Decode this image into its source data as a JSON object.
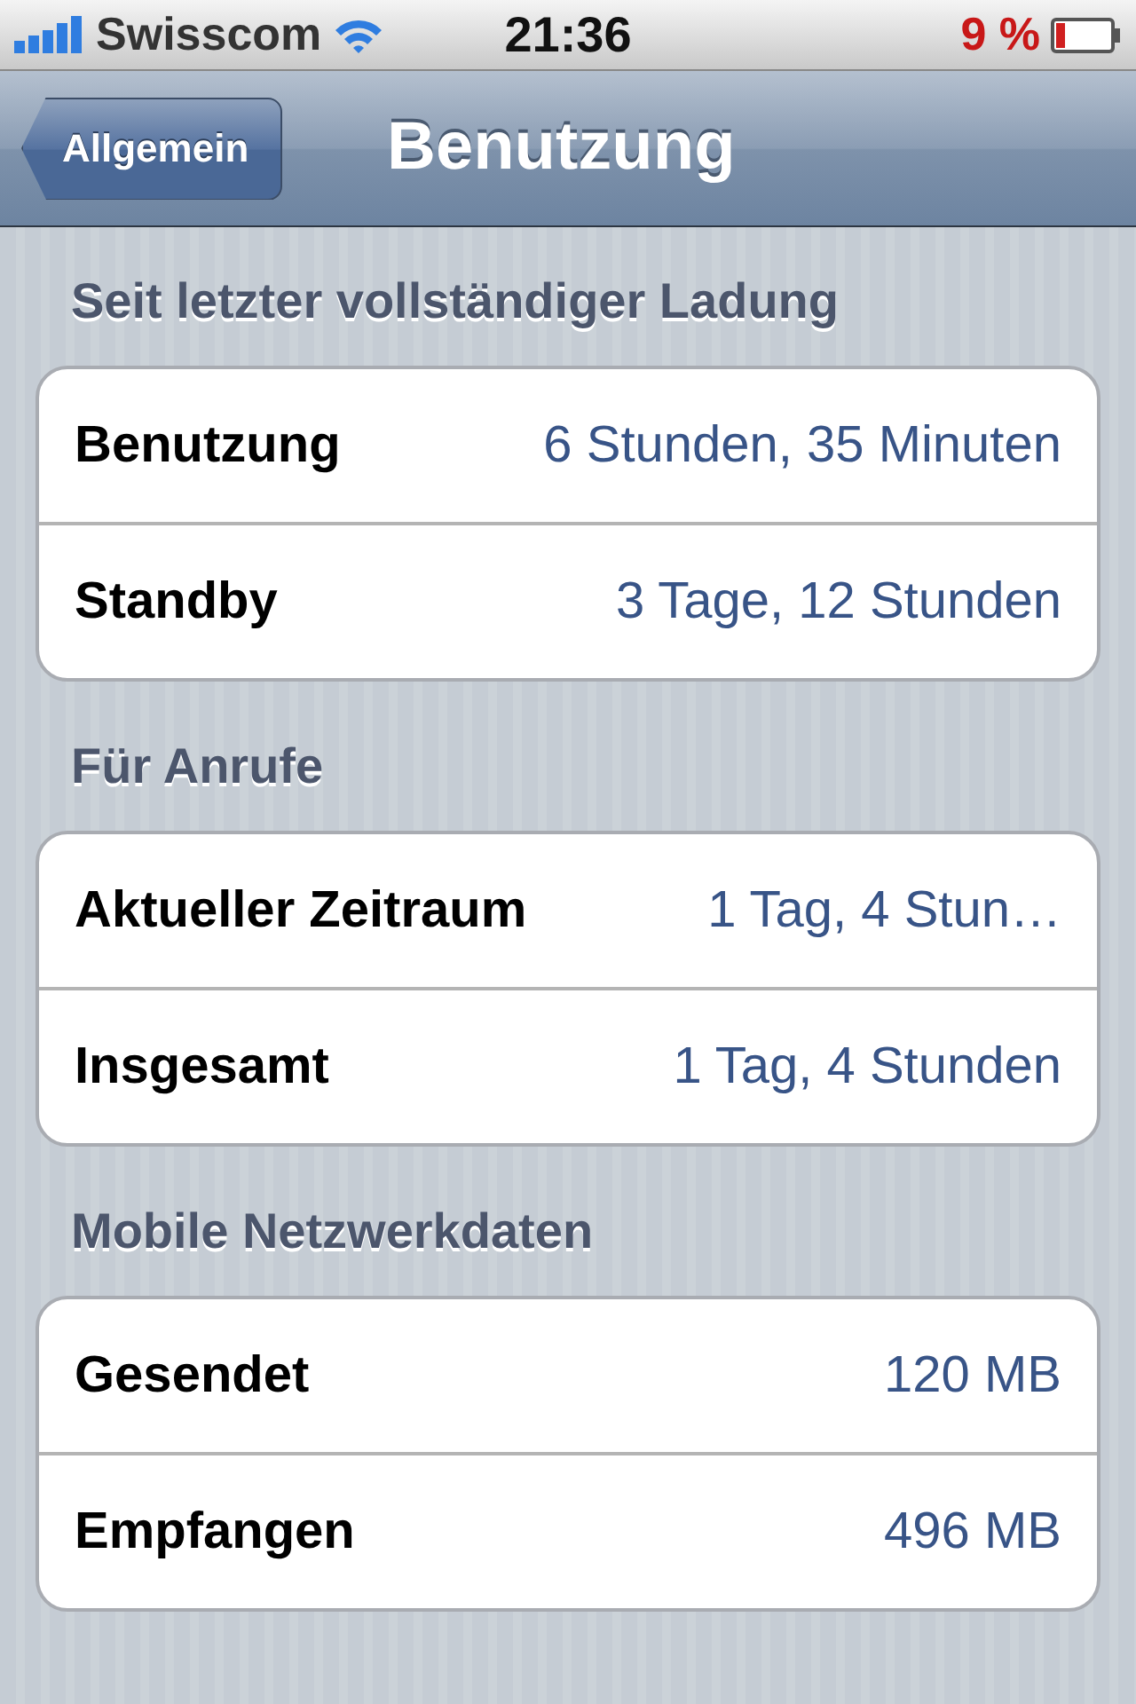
{
  "status_bar": {
    "carrier": "Swisscom",
    "time": "21:36",
    "battery": "9 %"
  },
  "nav_bar": {
    "back_button": "Allgemein",
    "title": "Benutzung"
  },
  "sections": [
    {
      "header": "Seit letzter vollständiger Ladung",
      "rows": [
        {
          "label": "Benutzung",
          "value": "6 Stunden, 35 Minuten"
        },
        {
          "label": "Standby",
          "value": "3 Tage, 12 Stunden"
        }
      ]
    },
    {
      "header": "Für Anrufe",
      "rows": [
        {
          "label": "Aktueller Zeitraum",
          "value": "1 Tag, 4 Stun…"
        },
        {
          "label": "Insgesamt",
          "value": "1 Tag, 4 Stunden"
        }
      ]
    },
    {
      "header": "Mobile Netzwerkdaten",
      "rows": [
        {
          "label": "Gesendet",
          "value": "120 MB"
        },
        {
          "label": "Empfangen",
          "value": "496 MB"
        }
      ]
    }
  ]
}
